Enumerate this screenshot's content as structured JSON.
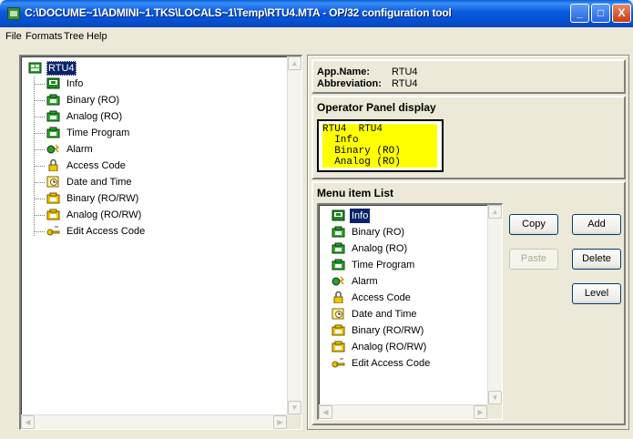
{
  "window": {
    "title": "C:\\DOCUME~1\\ADMINI~1.TKS\\LOCALS~1\\Temp\\RTU4.MTA - OP/32 configuration tool",
    "minimize": "_",
    "maximize": "□",
    "close": "X"
  },
  "menubar": [
    "File",
    "Formats",
    "Tree",
    "Help"
  ],
  "tree": {
    "root": "RTU4",
    "children": [
      "Info",
      "Binary (RO)",
      "Analog (RO)",
      "Time Program",
      "Alarm",
      "Access Code",
      "Date and Time",
      "Binary (RO/RW)",
      "Analog (RO/RW)",
      "Edit Access Code"
    ]
  },
  "app_info": {
    "name_label": "App.Name:",
    "name_value": "RTU4",
    "abbr_label": "Abbreviation:",
    "abbr_value": "RTU4"
  },
  "operator_panel": {
    "title": "Operator Panel display",
    "lines": [
      "RTU4  RTU4",
      "  Info",
      "  Binary (RO)",
      "  Analog (RO)"
    ]
  },
  "menu_item_list": {
    "title": "Menu item List",
    "items": [
      "Info",
      "Binary (RO)",
      "Analog (RO)",
      "Time Program",
      "Alarm",
      "Access Code",
      "Date and Time",
      "Binary (RO/RW)",
      "Analog (RO/RW)",
      "Edit Access Code"
    ],
    "selected": "Info"
  },
  "buttons": {
    "copy": "Copy",
    "add": "Add",
    "paste": "Paste",
    "delete": "Delete",
    "level": "Level"
  },
  "colors": {
    "title_bar": "#0858e0",
    "selection": "#0a246a",
    "display_highlight": "#ffff00"
  }
}
